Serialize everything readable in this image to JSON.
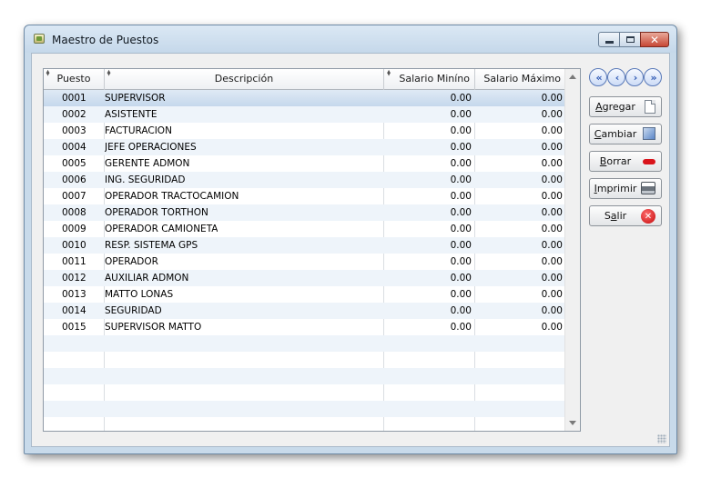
{
  "window": {
    "title": "Maestro de Puestos",
    "close_glyph": "✕"
  },
  "grid": {
    "columns": [
      {
        "key": "puesto",
        "label": "Puesto"
      },
      {
        "key": "descripcion",
        "label": "Descripción"
      },
      {
        "key": "salario_min",
        "label": "Salario Miníno"
      },
      {
        "key": "salario_max",
        "label": "Salario Máximo"
      }
    ],
    "selected_row": 0,
    "rows": [
      {
        "puesto": "0001",
        "descripcion": "SUPERVISOR",
        "salario_min": "0.00",
        "salario_max": "0.00"
      },
      {
        "puesto": "0002",
        "descripcion": "ASISTENTE",
        "salario_min": "0.00",
        "salario_max": "0.00"
      },
      {
        "puesto": "0003",
        "descripcion": "FACTURACION",
        "salario_min": "0.00",
        "salario_max": "0.00"
      },
      {
        "puesto": "0004",
        "descripcion": "JEFE OPERACIONES",
        "salario_min": "0.00",
        "salario_max": "0.00"
      },
      {
        "puesto": "0005",
        "descripcion": "GERENTE ADMON",
        "salario_min": "0.00",
        "salario_max": "0.00"
      },
      {
        "puesto": "0006",
        "descripcion": "ING. SEGURIDAD",
        "salario_min": "0.00",
        "salario_max": "0.00"
      },
      {
        "puesto": "0007",
        "descripcion": "OPERADOR TRACTOCAMION",
        "salario_min": "0.00",
        "salario_max": "0.00"
      },
      {
        "puesto": "0008",
        "descripcion": "OPERADOR TORTHON",
        "salario_min": "0.00",
        "salario_max": "0.00"
      },
      {
        "puesto": "0009",
        "descripcion": "OPERADOR CAMIONETA",
        "salario_min": "0.00",
        "salario_max": "0.00"
      },
      {
        "puesto": "0010",
        "descripcion": "RESP. SISTEMA GPS",
        "salario_min": "0.00",
        "salario_max": "0.00"
      },
      {
        "puesto": "0011",
        "descripcion": "OPERADOR",
        "salario_min": "0.00",
        "salario_max": "0.00"
      },
      {
        "puesto": "0012",
        "descripcion": "AUXILIAR ADMON",
        "salario_min": "0.00",
        "salario_max": "0.00"
      },
      {
        "puesto": "0013",
        "descripcion": "MATTO  LONAS",
        "salario_min": "0.00",
        "salario_max": "0.00"
      },
      {
        "puesto": "0014",
        "descripcion": "SEGURIDAD",
        "salario_min": "0.00",
        "salario_max": "0.00"
      },
      {
        "puesto": "0015",
        "descripcion": "SUPERVISOR MATTO",
        "salario_min": "0.00",
        "salario_max": "0.00"
      }
    ],
    "empty_rows": 6
  },
  "navigation": {
    "first": "«",
    "prev": "‹",
    "next": "›",
    "last": "»"
  },
  "actions": {
    "agregar": {
      "hotkey": "A",
      "rest": "gregar",
      "icon": "new-document-icon"
    },
    "cambiar": {
      "hotkey": "C",
      "rest": "ambiar",
      "icon": "edit-window-icon"
    },
    "borrar": {
      "hotkey": "B",
      "rest": "orrar",
      "icon": "delete-bar-icon"
    },
    "imprimir": {
      "hotkey": "I",
      "rest": "mprimir",
      "icon": "printer-icon"
    },
    "salir": {
      "pre": "S",
      "hotkey": "a",
      "rest": "lir",
      "icon": "exit-x-icon",
      "close_glyph": "✕"
    }
  }
}
